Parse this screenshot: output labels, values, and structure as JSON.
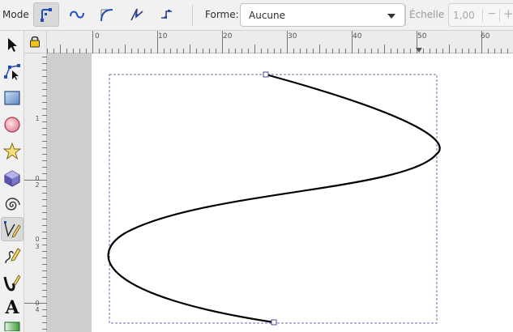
{
  "toolbar": {
    "mode_label": "Mode :",
    "mode_buttons": [
      {
        "name": "regular-bezier",
        "active": true
      },
      {
        "name": "spiro"
      },
      {
        "name": "bspline"
      },
      {
        "name": "zigzag"
      },
      {
        "name": "paraxial"
      }
    ],
    "shape_label": "Forme:",
    "shape_value": "Aucune",
    "scale_label": "Échelle :",
    "scale_value": "1,00",
    "scale_minus": "−",
    "scale_plus": "+"
  },
  "tools": [
    {
      "name": "selector-icon"
    },
    {
      "name": "node-editor-icon"
    },
    {
      "name": "rectangle-icon"
    },
    {
      "name": "circle-icon"
    },
    {
      "name": "star-icon"
    },
    {
      "name": "3d-box-icon"
    },
    {
      "name": "spiral-icon"
    },
    {
      "name": "pen-icon",
      "active": true
    },
    {
      "name": "pencil-icon"
    },
    {
      "name": "calligraphy-icon"
    },
    {
      "name": "text-icon",
      "glyph": "A"
    },
    {
      "name": "gradient-icon"
    }
  ],
  "ruler": {
    "horizontal_labels": [
      "0",
      "10",
      "20",
      "30",
      "40",
      "50",
      "60"
    ],
    "vertical_labels": [
      "1",
      "0",
      "2",
      "0",
      "3",
      "0",
      "4"
    ]
  },
  "colors": {
    "accent": "#1f4fb5",
    "canvas": "#ffffff",
    "desk": "#cfcfcf",
    "bbox_dash": "#6a6ab0",
    "path": "#000000"
  }
}
